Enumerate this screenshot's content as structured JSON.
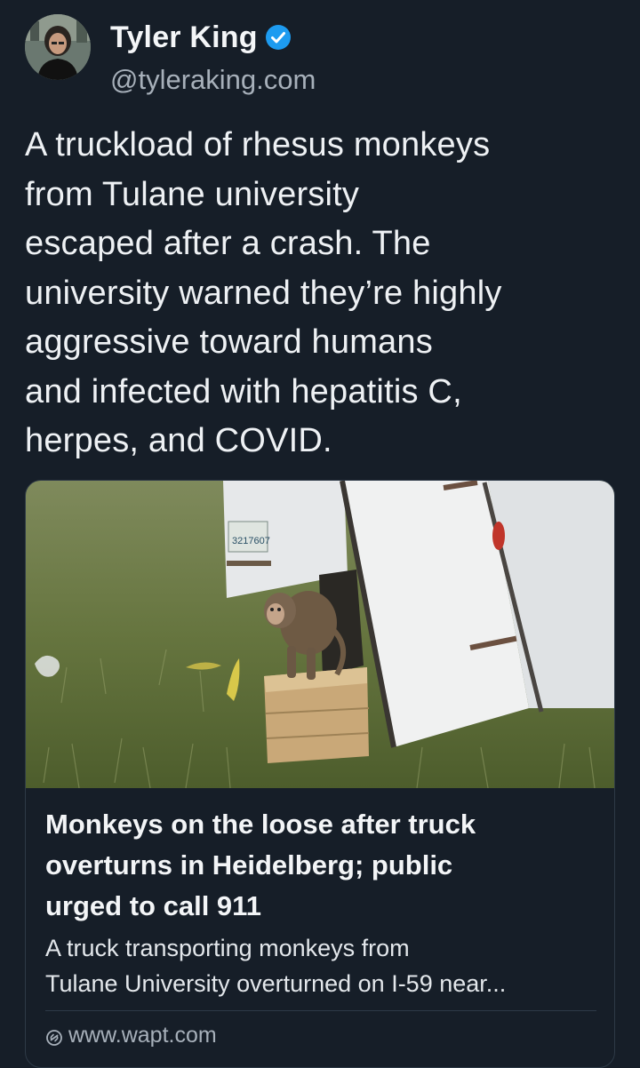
{
  "author": {
    "display_name": "Tyler King",
    "handle": "@tyleraking.com",
    "verified_icon": "verified-badge-icon",
    "avatar": "profile-photo"
  },
  "post": {
    "text": "A truckload of rhesus monkeys\nfrom Tulane university\nescaped after a crash. The\nuniversity warned they’re highly\naggressive toward humans\nand infected with hepatitis C,\nherpes, and COVID."
  },
  "link_card": {
    "image": "overturned-truck-with-monkey-photo",
    "title": "Monkeys on the loose after truck\noverturns in Heidelberg; public\nurged to call 911",
    "description": "A truck transporting monkeys from\nTulane University overturned on I-59 near...",
    "domain": "www.wapt.com",
    "domain_icon": "globe-link-icon",
    "plate_text": "3217607"
  },
  "colors": {
    "background": "#161e28",
    "verified": "#1d9bf0",
    "secondary_text": "#a7b0ba",
    "border": "#2e3a47"
  }
}
